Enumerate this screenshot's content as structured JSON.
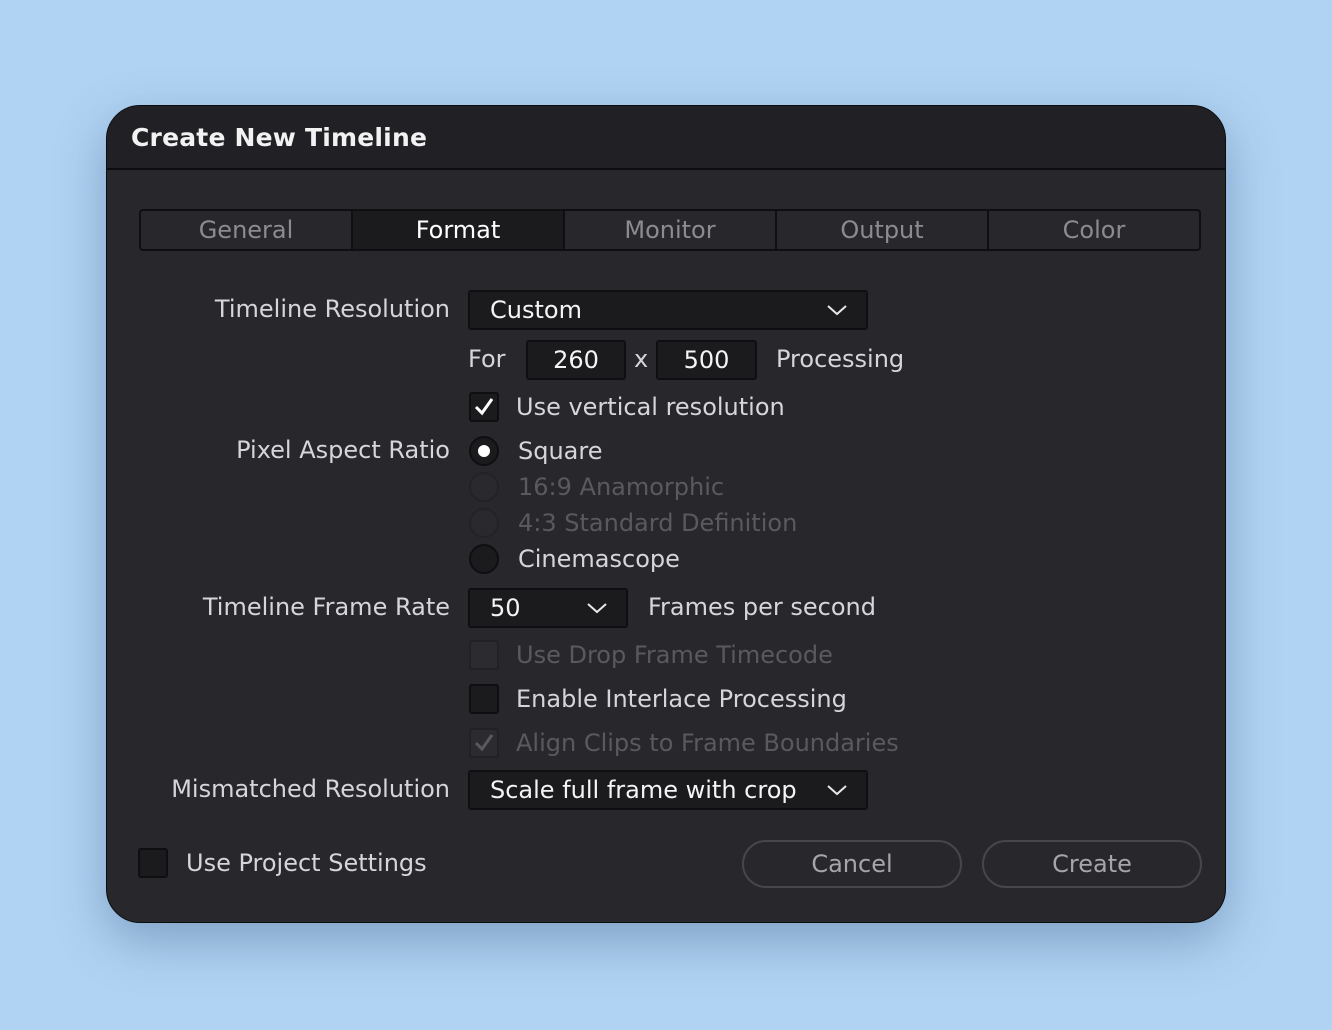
{
  "dialog": {
    "title": "Create New Timeline"
  },
  "tabs": [
    {
      "label": "General",
      "active": false
    },
    {
      "label": "Format",
      "active": true
    },
    {
      "label": "Monitor",
      "active": false
    },
    {
      "label": "Output",
      "active": false
    },
    {
      "label": "Color",
      "active": false
    }
  ],
  "resolution": {
    "label": "Timeline Resolution",
    "value": "Custom",
    "for_label": "For",
    "width": "260",
    "x_label": "x",
    "height": "500",
    "processing_label": "Processing",
    "vertical_label": "Use vertical resolution",
    "vertical_checked": true
  },
  "pixel_aspect": {
    "label": "Pixel Aspect Ratio",
    "options": [
      {
        "label": "Square",
        "selected": true,
        "enabled": true
      },
      {
        "label": "16:9 Anamorphic",
        "selected": false,
        "enabled": false
      },
      {
        "label": "4:3 Standard Definition",
        "selected": false,
        "enabled": false
      },
      {
        "label": "Cinemascope",
        "selected": false,
        "enabled": true
      }
    ]
  },
  "frame_rate": {
    "label": "Timeline Frame Rate",
    "value": "50",
    "unit": "Frames per second",
    "drop_frame_label": "Use Drop Frame Timecode",
    "interlace_label": "Enable Interlace Processing",
    "align_label": "Align Clips to Frame Boundaries"
  },
  "mismatched": {
    "label": "Mismatched Resolution",
    "value": "Scale full frame with crop"
  },
  "footer": {
    "project_settings_label": "Use Project Settings",
    "cancel_label": "Cancel",
    "create_label": "Create"
  },
  "colors": {
    "background": "#b0d3f3",
    "dialog": "#28282c",
    "field": "#1b1b1e",
    "text": "#d6d6d8",
    "disabled_text": "#5a5a5e"
  }
}
